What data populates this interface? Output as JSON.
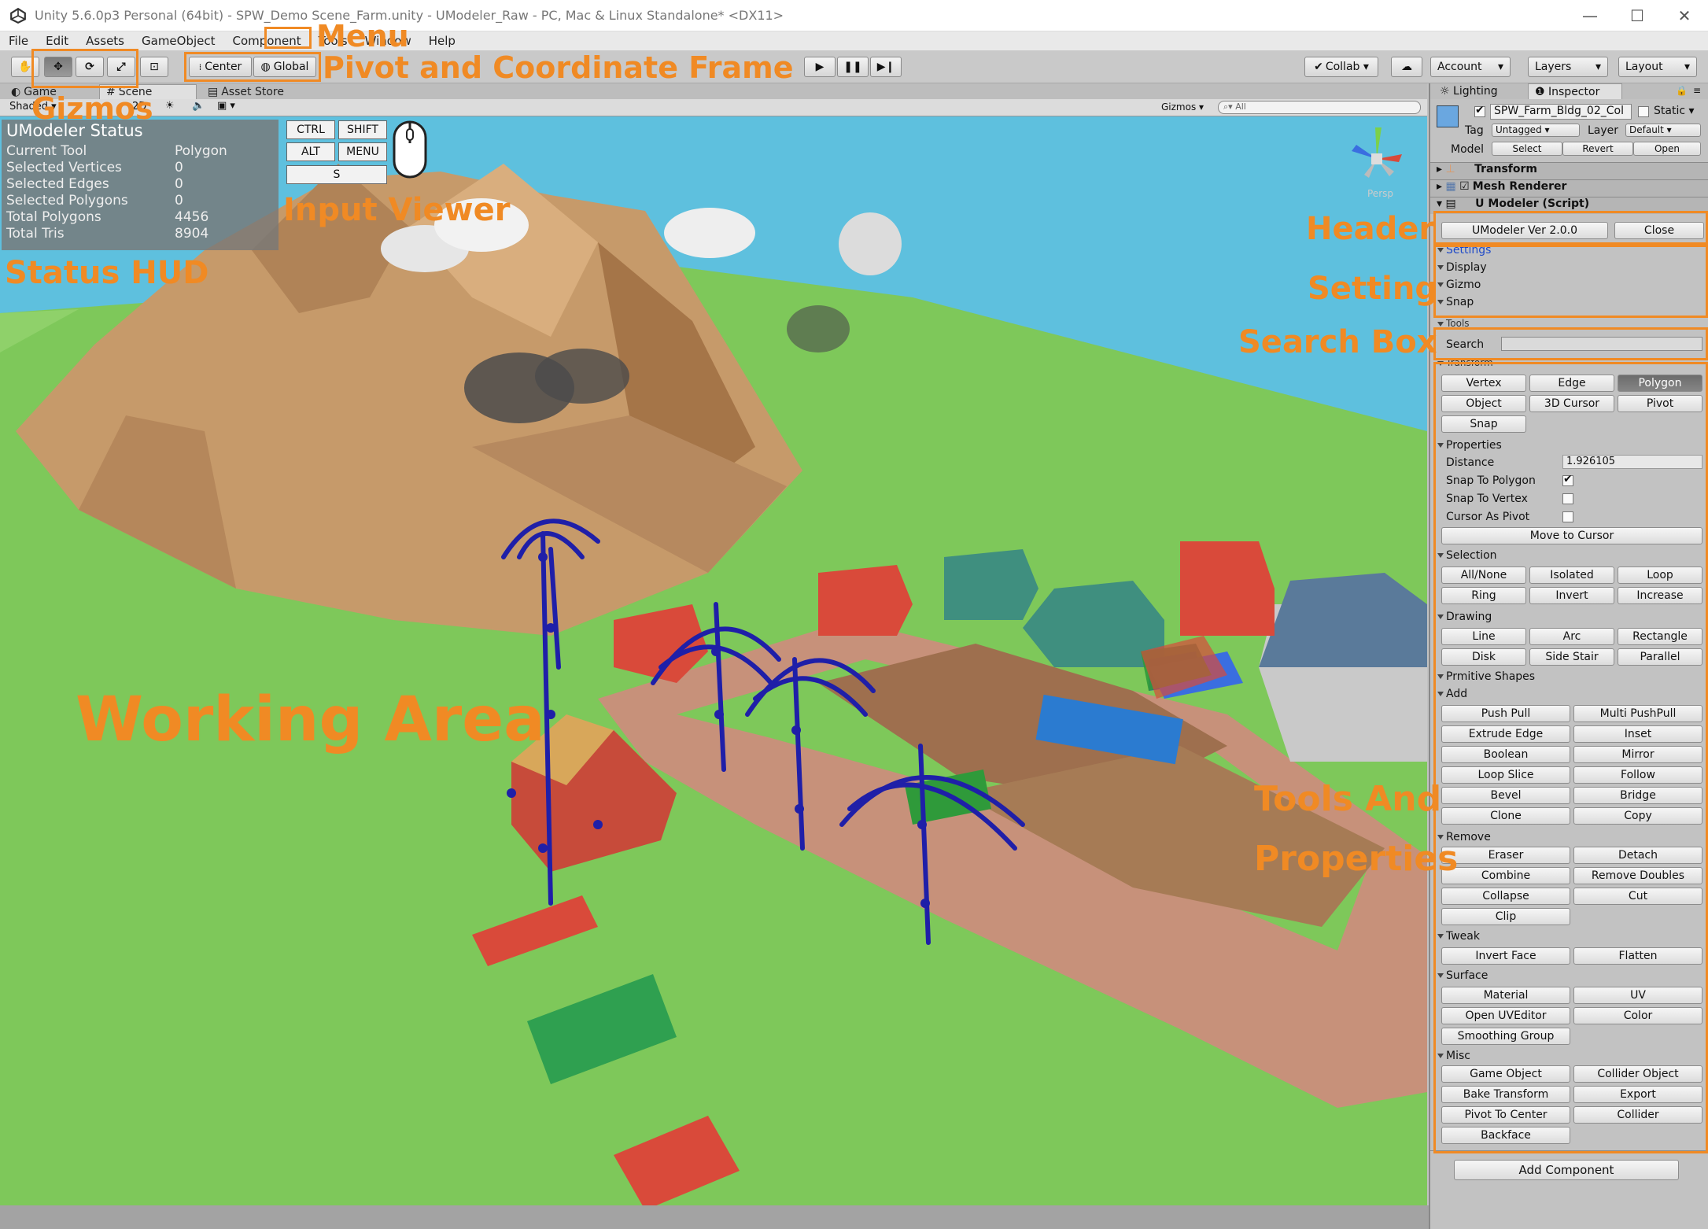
{
  "window": {
    "title": "Unity 5.6.0p3 Personal (64bit) - SPW_Demo Scene_Farm.unity - UModeler_Raw - PC, Mac & Linux Standalone* <DX11>",
    "minimize": "—",
    "maximize": "☐",
    "close": "✕"
  },
  "menu": {
    "file": "File",
    "edit": "Edit",
    "assets": "Assets",
    "gameobject": "GameObject",
    "component": "Component",
    "tools": "Tools",
    "window": "Window",
    "help": "Help"
  },
  "toolbar": {
    "center": "Center",
    "global": "Global",
    "collab": "Collab ▾",
    "account": "Account",
    "layers": "Layers",
    "layout": "Layout"
  },
  "tabs": {
    "game": "Game",
    "scene": "Scene",
    "asset_store": "Asset Store",
    "lighting": "Lighting",
    "inspector": "Inspector"
  },
  "scenebar": {
    "shaded": "Shaded",
    "mode2d": "2D",
    "gizmos": "Gizmos ▾",
    "search_placeholder": "All"
  },
  "hud": {
    "title": "UModeler Status",
    "rows": [
      {
        "label": "Current Tool",
        "value": "Polygon"
      },
      {
        "label": "Selected Vertices",
        "value": "0"
      },
      {
        "label": "Selected Edges",
        "value": "0"
      },
      {
        "label": "Selected Polygons",
        "value": "0"
      },
      {
        "label": "Total Polygons",
        "value": "4456"
      },
      {
        "label": "Total Tris",
        "value": "8904"
      }
    ]
  },
  "input_viewer": {
    "ctrl": "CTRL",
    "shift": "SHIFT",
    "alt": "ALT",
    "menu": "MENU",
    "s": "S"
  },
  "annotations": {
    "menu": "Menu",
    "pivot": "Pivot and Coordinate Frame",
    "gizmos": "Gizmos",
    "input_viewer": "Input Viewer",
    "status_hud": "Status HUD",
    "working_area": "Working Area",
    "header": "Header",
    "setting": "Setting",
    "search_box": "Search Box",
    "tools_line1": "Tools And",
    "tools_line2": "Properties"
  },
  "scene_gizmo": {
    "label": "Persp"
  },
  "inspector": {
    "object_name": "SPW_Farm_Bldg_02_Col",
    "static": "Static",
    "tag_label": "Tag",
    "tag_value": "Untagged",
    "layer_label": "Layer",
    "layer_value": "Default",
    "model_label": "Model",
    "select": "Select",
    "revert": "Revert",
    "open": "Open",
    "transform": "Transform",
    "mesh_renderer": "Mesh Renderer",
    "script": "U Modeler (Script)",
    "version": "UModeler Ver 2.0.0",
    "close": "Close",
    "settings": "Settings",
    "display": "Display",
    "gizmo": "Gizmo",
    "snap_section": "Snap",
    "tools_section": "Tools",
    "search": "Search",
    "transform_section": "Transform",
    "vertex": "Vertex",
    "edge": "Edge",
    "polygon": "Polygon",
    "object": "Object",
    "cursor3d": "3D Cursor",
    "pivot": "Pivot",
    "snap": "Snap",
    "properties": "Properties",
    "distance_label": "Distance",
    "distance_value": "1.926105",
    "snap_to_polygon": "Snap To Polygon",
    "snap_to_vertex": "Snap To Vertex",
    "cursor_as_pivot": "Cursor As Pivot",
    "move_to_cursor": "Move to Cursor",
    "selection": "Selection",
    "allnone": "All/None",
    "isolated": "Isolated",
    "loop": "Loop",
    "ring": "Ring",
    "invert": "Invert",
    "increase": "Increase",
    "drawing": "Drawing",
    "line": "Line",
    "arc": "Arc",
    "rectangle": "Rectangle",
    "disk": "Disk",
    "side_stair": "Side Stair",
    "parallel": "Parallel",
    "primitive_shapes": "Prmitive Shapes",
    "add": "Add",
    "push_pull": "Push Pull",
    "multi_push_pull": "Multi PushPull",
    "extrude_edge": "Extrude Edge",
    "inset": "Inset",
    "boolean": "Boolean",
    "mirror": "Mirror",
    "loop_slice": "Loop Slice",
    "follow": "Follow",
    "bevel": "Bevel",
    "bridge": "Bridge",
    "clone": "Clone",
    "copy": "Copy",
    "remove": "Remove",
    "eraser": "Eraser",
    "detach": "Detach",
    "combine": "Combine",
    "remove_doubles": "Remove Doubles",
    "collapse": "Collapse",
    "cut": "Cut",
    "clip": "Clip",
    "tweak": "Tweak",
    "invert_face": "Invert Face",
    "flatten": "Flatten",
    "surface": "Surface",
    "material": "Material",
    "uv": "UV",
    "open_uveditor": "Open UVEditor",
    "color": "Color",
    "smoothing_group": "Smoothing Group",
    "misc": "Misc",
    "game_object": "Game Object",
    "collider_object": "Collider Object",
    "bake_transform": "Bake Transform",
    "export": "Export",
    "pivot_to_center": "Pivot To Center",
    "collider": "Collider",
    "backface": "Backface",
    "add_component": "Add Component"
  },
  "colors": {
    "annotation": "#f08a24",
    "wire": "#1f1fa8",
    "ground": "#7ec85a",
    "sea": "#5ec0de",
    "road": "#c7917a"
  }
}
